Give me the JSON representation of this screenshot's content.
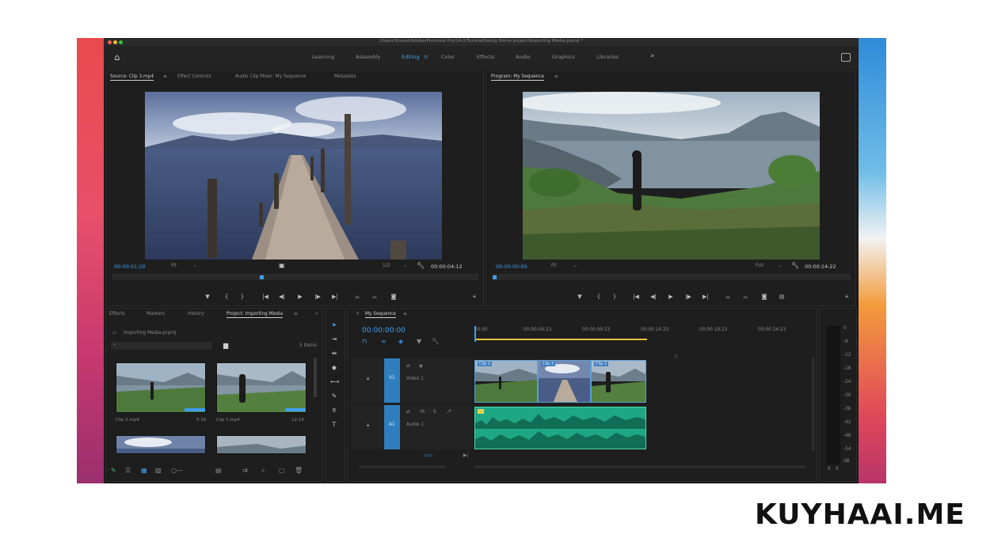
{
  "window": {
    "title": "/Users/Shared/Adobe/Premiere Pro/14.0/Tutorial/Going Home project/Importing Media.prproj *"
  },
  "workspaces": {
    "items": [
      "Learning",
      "Assembly",
      "Editing",
      "Color",
      "Effects",
      "Audio",
      "Graphics",
      "Libraries"
    ],
    "active": "Editing",
    "more": "»"
  },
  "source_monitor": {
    "tabs": [
      "Source: Clip 3.mp4",
      "Effect Controls",
      "Audio Clip Mixer: My Sequence",
      "Metadata"
    ],
    "timecode_in": "00:00:01:20",
    "fit": "Fit",
    "resolution": "1/2",
    "timecode_out": "00:00:04:12"
  },
  "program_monitor": {
    "tab": "Program: My Sequence",
    "timecode_in": "00:00:00:00",
    "fit": "Fit",
    "resolution": "Full",
    "timecode_out": "00:00:14:22"
  },
  "project_panel": {
    "tabs": [
      "Effects",
      "Markers",
      "History",
      "Project: Importing Media"
    ],
    "project_file": "Importing Media.prproj",
    "item_count": "5 Items",
    "clips": [
      {
        "name": "Clip 2.mp4",
        "duration": "5:16"
      },
      {
        "name": "Clip 1.mp4",
        "duration": "12:14"
      }
    ]
  },
  "timeline": {
    "tab": "My Sequence",
    "timecode": "00:00:00:00",
    "ruler": [
      "00:00",
      "00:00:04:23",
      "00:00:09:23",
      "00:00:14:23",
      "00:00:19:23",
      "00:00:24:23"
    ],
    "video_track": {
      "name": "V1",
      "label": "Video 1"
    },
    "audio_track": {
      "name": "A1",
      "label": "Audio 1"
    },
    "clips": [
      {
        "label": "Clip 1"
      },
      {
        "label": "Clip 3"
      },
      {
        "label": "Clip 2"
      }
    ],
    "meter_scale": [
      "0",
      "-6",
      "-12",
      "-18",
      "-24",
      "-30",
      "-36",
      "-42",
      "-48",
      "-54",
      "dB"
    ]
  },
  "brand": {
    "text": "KUYHAAI.ME"
  },
  "colors": {
    "accent": "#3f9ef0",
    "audio_clip": "#1fa784",
    "playhead": "#e8c23a"
  }
}
